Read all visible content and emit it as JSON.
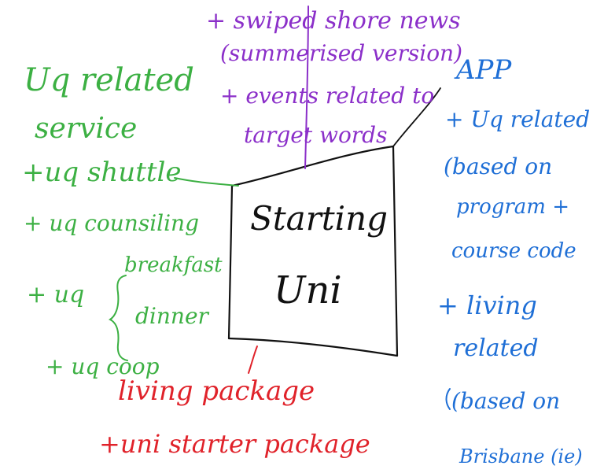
{
  "colors": {
    "green": "#3cb043",
    "purple": "#8b2fc9",
    "blue": "#1f6fd6",
    "red": "#e0222a",
    "ink": "#111111"
  },
  "center": {
    "line1": "Starting",
    "line2": "Uni"
  },
  "top_notes": {
    "l1": "+ swiped shore news",
    "l2": "(summerised version)",
    "l3": "+ events related to",
    "l4": "target words"
  },
  "left_notes": {
    "l1": "Uq related",
    "l2": "service",
    "l3": "+uq shuttle",
    "l4": "+ uq counsiling",
    "l5": "+ uq",
    "l6": "breakfast",
    "l7": "dinner",
    "l8": "+ uq coop"
  },
  "right_notes": {
    "l1": "APP",
    "l2": "+ Uq related",
    "l3": "(based on",
    "l4": "program +",
    "l5": "course code",
    "l6": "+ living",
    "l7": "related",
    "l8": "(based on",
    "l9": "Brisbane (ie)"
  },
  "bottom_notes": {
    "l1": "living package",
    "l2": "+uni starter package"
  }
}
